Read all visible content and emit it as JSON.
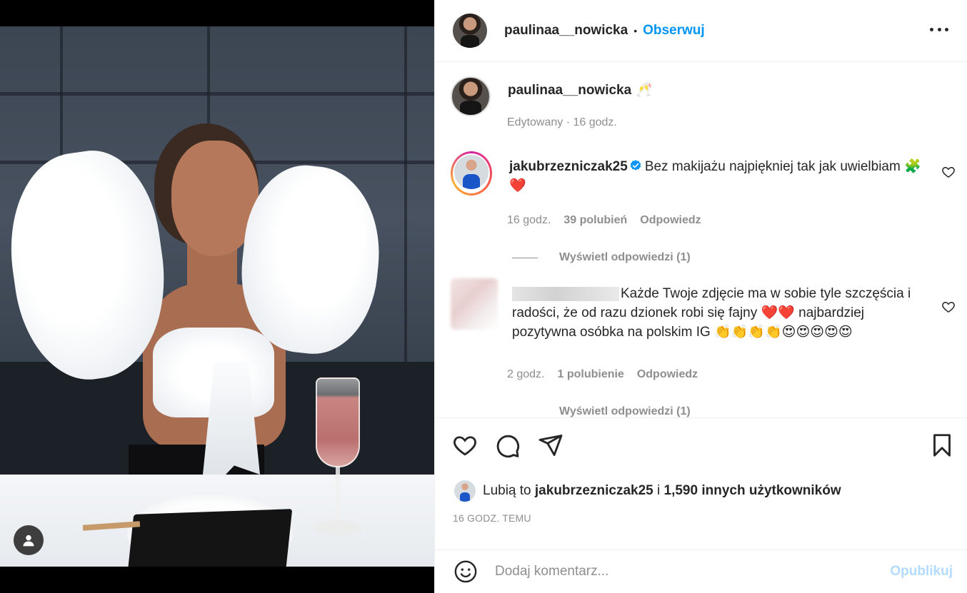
{
  "post": {
    "author": "paulinaa__nowicka",
    "follow_label": "Obserwuj",
    "caption_emoji": "🥂",
    "caption_meta": "Edytowany · 16 godz."
  },
  "comments": [
    {
      "username": "jakubrzezniczak25",
      "verified": true,
      "text": "Bez makijażu najpiękniej tak jak uwielbiam",
      "emoji": "🧩❤️",
      "time": "16 godz.",
      "likes": "39 polubień",
      "reply_label": "Odpowiedz",
      "view_replies": "Wyświetl odpowiedzi (1)"
    },
    {
      "username_hidden": true,
      "text": "Każde Twoje zdjęcie ma w sobie tyle szczęścia i radości, że od razu dzionek robi się fajny",
      "emoji_mid": "❤️❤️",
      "text2": "najbardziej pozytywna osóbka na polskim IG",
      "emoji_end": "👏👏👏👏😍😍😍😍😍",
      "time": "2 godz.",
      "likes": "1 polubienie",
      "reply_label": "Odpowiedz",
      "view_replies": "Wyświetl odpowiedzi (1)"
    }
  ],
  "likes": {
    "prefix": "Lubią to",
    "user": "jakubrzezniczak25",
    "joiner": "i",
    "others": "1,590 innych użytkowników"
  },
  "time_ago": "16 GODZ. TEMU",
  "add_comment": {
    "placeholder": "Dodaj komentarz...",
    "publish_label": "Opublikuj"
  },
  "icons": {
    "more": "more-dots-icon",
    "like": "heart-icon",
    "comment": "comment-bubble-icon",
    "share": "paper-plane-icon",
    "save": "bookmark-icon",
    "emoji": "smiley-icon",
    "tagged_user": "user-tag-icon",
    "verified": "verified-badge-icon"
  },
  "colors": {
    "accent": "#0095f6",
    "publish_disabled": "#b3dbff",
    "muted": "#8e8e8e"
  }
}
